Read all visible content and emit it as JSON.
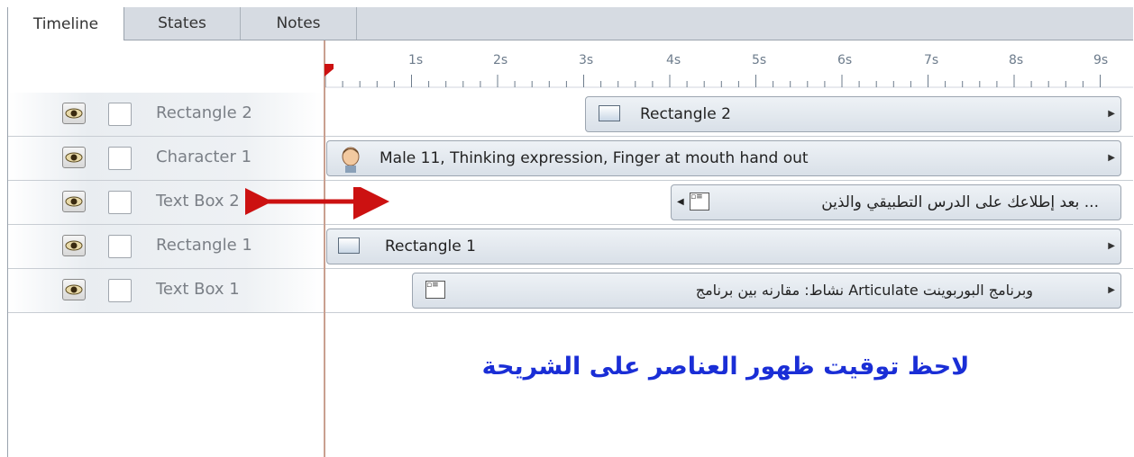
{
  "tabs": [
    {
      "label": "Timeline",
      "active": true
    },
    {
      "label": "States",
      "active": false
    },
    {
      "label": "Notes",
      "active": false
    }
  ],
  "ruler": {
    "ticks": [
      "1s",
      "2s",
      "3s",
      "4s",
      "5s",
      "6s",
      "7s",
      "8s",
      "9s"
    ]
  },
  "layers": [
    {
      "name": "Rectangle 2"
    },
    {
      "name": "Character 1"
    },
    {
      "name": "Text Box 2"
    },
    {
      "name": "Rectangle 1"
    },
    {
      "name": "Text Box 1"
    }
  ],
  "timeline_bars": [
    {
      "label": "Rectangle 2",
      "icon": "rectangle-shape-icon",
      "start_seconds": 3.0
    },
    {
      "label": "Male 11, Thinking expression, Finger at mouth hand out",
      "icon": "character-avatar-icon",
      "start_seconds": 0.0
    },
    {
      "label": "... بعد إطلاعك على الدرس التطبيقي والذين",
      "icon": "text-box-icon",
      "start_seconds": 4.0
    },
    {
      "label": "Rectangle 1",
      "icon": "rectangle-shape-icon",
      "start_seconds": 0.0
    },
    {
      "label": "وبرنامج البوربوينت  Articulate نشاط: مقارنه بين برنامج",
      "icon": "text-box-icon",
      "start_seconds": 1.0
    }
  ],
  "annotation": {
    "caption": "لاحظ توقيت ظهور العناصر على الشريحة",
    "arrow_color": "#cc1111",
    "caption_color": "#1a2ed6"
  },
  "colors": {
    "playhead": "#cc1111",
    "tab_strip": "#d6dbe2"
  }
}
